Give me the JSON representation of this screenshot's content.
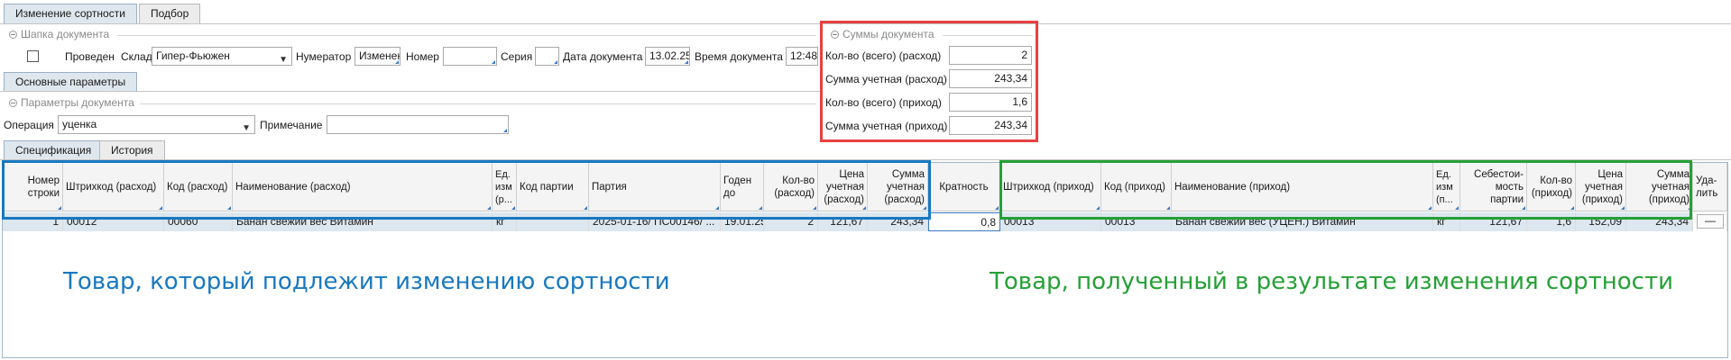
{
  "top_tabs": [
    "Изменение сортности",
    "Подбор"
  ],
  "header": {
    "group_title": "Шапка документа",
    "posted_label": "Проведен",
    "warehouse_label": "Склад",
    "warehouse_value": "Гипер-Фьюжен",
    "numerator_label": "Нумератор",
    "numerator_value": "Изменен",
    "number_label": "Номер",
    "number_value": "",
    "series_label": "Серия",
    "series_value": "",
    "date_label": "Дата документа",
    "date_value": "13.02.25",
    "time_label": "Время документа",
    "time_value": "12:48"
  },
  "main_params_tab": "Основные параметры",
  "params": {
    "group_title": "Параметры документа",
    "operation_label": "Операция",
    "operation_value": "уценка",
    "note_label": "Примечание",
    "note_value": ""
  },
  "sums": {
    "group_title": "Суммы документа",
    "rows": [
      {
        "label": "Кол-во (всего) (расход)",
        "value": "2"
      },
      {
        "label": "Сумма учетная (расход)",
        "value": "243,34"
      },
      {
        "label": "Кол-во (всего) (приход)",
        "value": "1,6"
      },
      {
        "label": "Сумма учетная (приход)",
        "value": "243,34"
      }
    ]
  },
  "spec_tabs": [
    "Спецификация",
    "История"
  ],
  "table": {
    "columns": [
      "Номер строки",
      "Штрихкод (расход)",
      "Код (расход)",
      "Наименование (расход)",
      "Ед. изм (р...",
      "Код партии",
      "Партия",
      "Годен до",
      "Кол-во (расход)",
      "Цена учетная (расход)",
      "Сумма учетная (расход)",
      "Кратность",
      "Штрихкод (приход)",
      "Код (приход)",
      "Наименование (приход)",
      "Ед. изм (п...",
      "Себестои- мость партии",
      "Кол-во (приход)",
      "Цена учетная (приход)",
      "Сумма учетная (приход)",
      "Уда- лить"
    ],
    "row": [
      "1",
      "00012",
      "00060",
      "Банан свежий вес Витамин",
      "кг",
      "",
      "2025-01-16/ ПС00146/ ...",
      "19.01.25",
      "2",
      "121,67",
      "243,34",
      "0,8",
      "00013",
      "00013",
      "Банан свежий вес (УЦЕН.) Витамин",
      "кг",
      "121,67",
      "1,6",
      "152,09",
      "243,34",
      "—"
    ]
  },
  "annotations": {
    "left": "Товар, который подлежит изменению сортности",
    "right": "Товар, полученный в результате изменения сортности"
  },
  "colors": {
    "red_box": "#e84040",
    "blue_box": "#1878c0",
    "green_box": "#25a035",
    "selected_row": "#dce7ef"
  }
}
